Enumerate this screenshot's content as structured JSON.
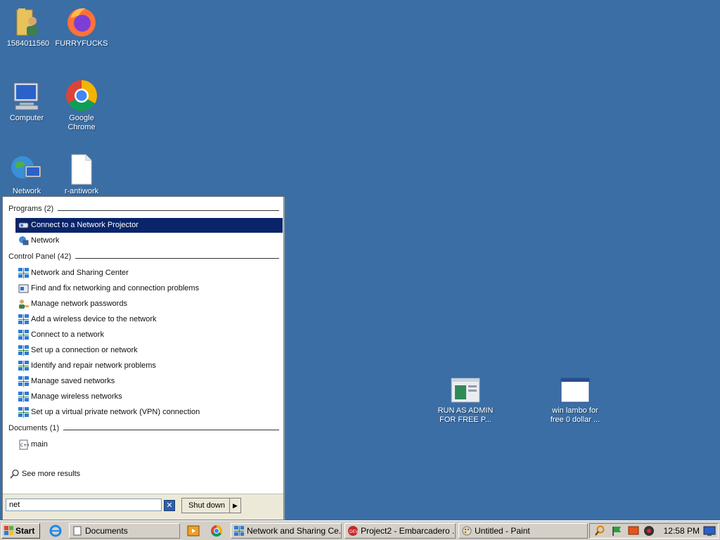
{
  "desktop": {
    "icons": [
      {
        "label": "1584011560"
      },
      {
        "label": "FURRYFUCKS"
      },
      {
        "label": "Computer"
      },
      {
        "label": "Google Chrome"
      },
      {
        "label": "Network"
      },
      {
        "label": "r-antiwork"
      },
      {
        "label": "RUN AS ADMIN FOR FREE P..."
      },
      {
        "label": "win lambo for free 0 dollar ..."
      }
    ]
  },
  "start_menu": {
    "groups": {
      "programs": "Programs (2)",
      "control_panel": "Control Panel (42)",
      "documents": "Documents (1)"
    },
    "programs": [
      {
        "label": "Connect to a Network Projector",
        "selected": true
      },
      {
        "label": "Network"
      }
    ],
    "control_panel": [
      {
        "label": "Network and Sharing Center"
      },
      {
        "label": "Find and fix networking and connection problems"
      },
      {
        "label": "Manage network passwords"
      },
      {
        "label": "Add a wireless device to the network"
      },
      {
        "label": "Connect to a network"
      },
      {
        "label": "Set up a connection or network"
      },
      {
        "label": "Identify and repair network problems"
      },
      {
        "label": "Manage saved networks"
      },
      {
        "label": "Manage wireless networks"
      },
      {
        "label": "Set up a virtual private network (VPN) connection"
      }
    ],
    "documents": [
      {
        "label": "main"
      }
    ],
    "see_more": "See more results",
    "search_value": "net",
    "shutdown_label": "Shut down"
  },
  "taskbar": {
    "start_label": "Start",
    "buttons": [
      {
        "label": "Documents"
      },
      {
        "label": "Network and Sharing Ce..."
      },
      {
        "label": "Project2 - Embarcadero ..."
      },
      {
        "label": "Untitled - Paint"
      }
    ],
    "clock": "12:58 PM"
  },
  "colors": {
    "desktop": "#3a6ea5",
    "selection": "#0a246a"
  }
}
